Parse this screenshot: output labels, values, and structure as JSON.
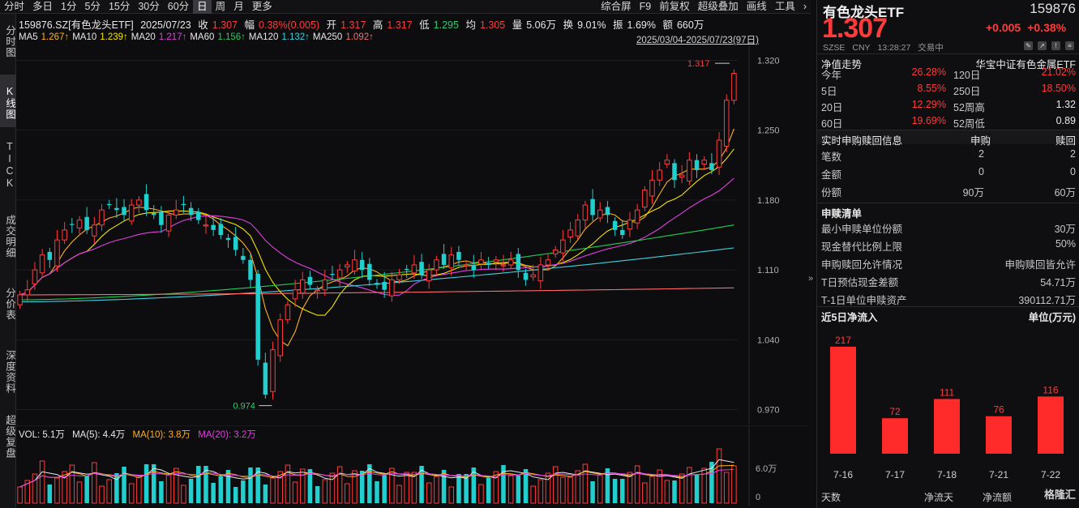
{
  "toolbar": {
    "left": [
      "分时",
      "多日",
      "1分",
      "5分",
      "15分",
      "30分",
      "60分",
      "日",
      "周",
      "月",
      "更多"
    ],
    "active": "日",
    "right": [
      "综合屏",
      "F9",
      "前复权",
      "超级叠加",
      "画线",
      "工具"
    ]
  },
  "left_tabs": [
    {
      "label": "分时图",
      "active": false
    },
    {
      "label": "K线图",
      "active": true
    },
    {
      "label": "TICK",
      "active": false
    },
    {
      "label": "成交明细",
      "active": false
    },
    {
      "label": "分价表",
      "active": false
    },
    {
      "label": "深度资料",
      "active": false
    },
    {
      "label": "超级复盘",
      "active": false
    }
  ],
  "info": {
    "code": "159876.SZ[有色龙头ETF]",
    "date": "2025/07/23",
    "close_label": "收",
    "close": "1.307",
    "range_label": "幅",
    "range": "0.38%(0.005)",
    "open_label": "开",
    "open": "1.317",
    "high_label": "高",
    "high": "1.317",
    "low_label": "低",
    "low": "1.295",
    "avg_label": "均",
    "avg": "1.305",
    "vol_label": "量",
    "vol": "5.06万",
    "turn_label": "换",
    "turn": "9.01%",
    "amp_label": "振",
    "amp": "1.69%",
    "amt_label": "额",
    "amt": "660万"
  },
  "ma": [
    {
      "name": "MA5",
      "value": "1.267↑",
      "color": "#ffb020"
    },
    {
      "name": "MA10",
      "value": "1.239↑",
      "color": "#f5e400"
    },
    {
      "name": "MA20",
      "value": "1.217↑",
      "color": "#e040e0"
    },
    {
      "name": "MA60",
      "value": "1.156↑",
      "color": "#22cc55"
    },
    {
      "name": "MA120",
      "value": "1.132↑",
      "color": "#40d0e0"
    },
    {
      "name": "MA250",
      "value": "1.092↑",
      "color": "#ff6a6a"
    }
  ],
  "date_range": "2025/03/04-2025/07/23(97日)",
  "chart_data": {
    "type": "candlestick",
    "ylim": [
      0.955,
      1.335
    ],
    "y_ticks": [
      "1.320",
      "1.250",
      "1.180",
      "1.110",
      "1.040",
      "0.970"
    ],
    "max_label": "1.317",
    "min_label": "0.974",
    "candles_close": [
      1.085,
      1.09,
      1.11,
      1.125,
      1.12,
      1.14,
      1.15,
      1.155,
      1.16,
      1.15,
      1.155,
      1.17,
      1.175,
      1.17,
      1.165,
      1.175,
      1.18,
      1.17,
      1.165,
      1.155,
      1.165,
      1.17,
      1.175,
      1.165,
      1.16,
      1.155,
      1.15,
      1.145,
      1.14,
      1.13,
      1.12,
      1.1,
      1.02,
      0.985,
      1.03,
      1.06,
      1.075,
      1.09,
      1.1,
      1.095,
      1.09,
      1.1,
      1.105,
      1.11,
      1.115,
      1.12,
      1.11,
      1.1,
      1.095,
      1.09,
      1.1,
      1.105,
      1.11,
      1.115,
      1.105,
      1.11,
      1.12,
      1.115,
      1.125,
      1.12,
      1.115,
      1.11,
      1.12,
      1.115,
      1.12,
      1.115,
      1.12,
      1.11,
      1.1,
      1.105,
      1.115,
      1.12,
      1.13,
      1.14,
      1.15,
      1.16,
      1.175,
      1.165,
      1.17,
      1.165,
      1.15,
      1.145,
      1.16,
      1.17,
      1.19,
      1.2,
      1.21,
      1.22,
      1.2,
      1.205,
      1.22,
      1.21,
      1.22,
      1.21,
      1.24,
      1.28,
      1.307
    ],
    "volume": {
      "vol_label": "VOL: 5.1万",
      "ma5_label": "MA(5): 4.4万",
      "ma10_label": "MA(10): 3.8万",
      "ma20_label": "MA(20): 3.2万",
      "y_ticks": [
        "6.0万",
        "0"
      ]
    },
    "colors": {
      "up": "#ff3b3b",
      "down": "#22cfcf"
    }
  },
  "right": {
    "name": "有色龙头ETF",
    "code": "159876",
    "price": "1.307",
    "change": "+0.005",
    "change_pct": "+0.38%",
    "market": "SZSE",
    "currency": "CNY",
    "time": "13:28:27",
    "status": "交易中",
    "nav_title": "净值走势",
    "nav_index": "华宝中证有色金属ETF",
    "perf": [
      {
        "l1": "今年",
        "v1": "26.28%",
        "l2": "120日",
        "v2": "21.02%",
        "c1": "red",
        "c2": "red"
      },
      {
        "l1": "5日",
        "v1": "8.55%",
        "l2": "250日",
        "v2": "18.50%",
        "c1": "red",
        "c2": "red"
      },
      {
        "l1": "20日",
        "v1": "12.29%",
        "l2": "52周高",
        "v2": "1.32",
        "c1": "red",
        "c2": "white"
      },
      {
        "l1": "60日",
        "v1": "19.69%",
        "l2": "52周低",
        "v2": "0.89",
        "c1": "red",
        "c2": "white"
      }
    ],
    "sub_title": "实时申购赎回信息",
    "sub_col1": "申购",
    "sub_col2": "赎回",
    "sub_rows": [
      {
        "label": "笔数",
        "a": "2",
        "b": "2"
      },
      {
        "label": "金额",
        "a": "0",
        "b": "0"
      },
      {
        "label": "份额",
        "a": "90万",
        "b": "60万"
      }
    ],
    "list_title": "申赎清单",
    "list_rows": [
      {
        "label": "最小申赎单位份额",
        "value": "30万"
      },
      {
        "label": "现金替代比例上限",
        "value": "50%"
      },
      {
        "label": "申购赎回允许情况",
        "value": "申购赎回皆允许"
      },
      {
        "label": "T日预估现金差额",
        "value": "54.71万"
      },
      {
        "label": "T-1日单位申赎资产",
        "value": "390112.71万"
      }
    ],
    "flow_title": "近5日净流入",
    "flow_unit": "单位(万元)",
    "flow": {
      "type": "bar",
      "categories": [
        "7-16",
        "7-17",
        "7-18",
        "7-21",
        "7-22"
      ],
      "values": [
        217,
        72,
        111,
        76,
        116
      ],
      "ylim": [
        0,
        230
      ]
    },
    "bottom_tabs": [
      "天数",
      "净流天",
      "净流额"
    ],
    "logo": "格隆汇"
  }
}
